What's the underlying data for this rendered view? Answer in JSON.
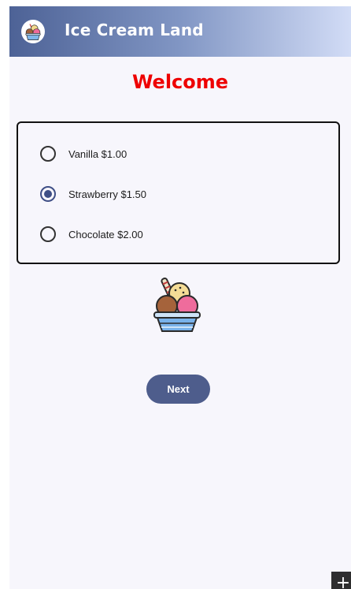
{
  "app_bar": {
    "title": "Ice Cream Land",
    "logo_icon": "ice-cream-sundae-icon",
    "gradient_colors": [
      "#4d6296",
      "#d2dcf6"
    ]
  },
  "heading": {
    "text": "Welcome",
    "color": "#ee0000"
  },
  "flavor_options": [
    {
      "label": "Vanilla $1.00",
      "selected": false
    },
    {
      "label": "Strawberry $1.50",
      "selected": true
    },
    {
      "label": "Chocolate $2.00",
      "selected": false
    }
  ],
  "illustration": {
    "icon": "ice-cream-sundae-icon"
  },
  "next_button": {
    "label": "Next",
    "color": "#4e5d8c"
  },
  "corner_button": {
    "icon": "plus-icon",
    "glyph": "+"
  }
}
